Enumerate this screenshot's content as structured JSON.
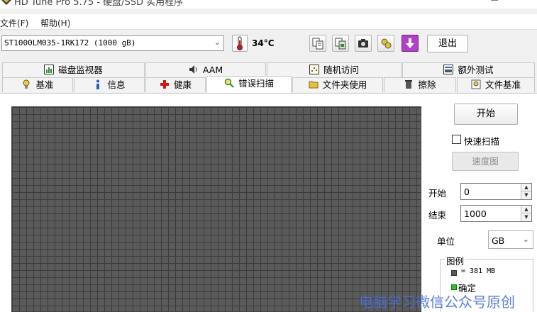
{
  "window": {
    "title": "HD Tune Pro 5.75 - 硬盘/SSD 实用程序",
    "minimize": "–",
    "maximize": "☐",
    "close": "✕"
  },
  "menu": {
    "file": "文件(F)",
    "help": "帮助(H)"
  },
  "toolbar": {
    "drive": "ST1000LM035-1RK172 (1000 gB)",
    "temperature": "34°C",
    "icons": [
      "copy-info-icon",
      "copy-screenshot-icon",
      "camera-icon",
      "options-icon",
      "save-icon"
    ],
    "exit_label": "退出"
  },
  "tabs": {
    "row1": [
      {
        "label": "磁盘监视器",
        "icon": "disk-monitor-icon"
      },
      {
        "label": "AAM",
        "icon": "speaker-icon"
      },
      {
        "label": "随机访问",
        "icon": "random-access-icon"
      },
      {
        "label": "额外测试",
        "icon": "extra-tests-icon"
      }
    ],
    "row2": [
      {
        "label": "基准",
        "icon": "benchmark-icon"
      },
      {
        "label": "信息",
        "icon": "info-icon"
      },
      {
        "label": "健康",
        "icon": "health-icon"
      },
      {
        "label": "错误扫描",
        "icon": "error-scan-icon",
        "active": true
      },
      {
        "label": "文件夹使用",
        "icon": "folder-usage-icon"
      },
      {
        "label": "擦除",
        "icon": "erase-icon"
      },
      {
        "label": "文件基准",
        "icon": "file-benchmark-icon"
      }
    ]
  },
  "scan": {
    "start_button": "开始",
    "quick_scan_label": "快速扫描",
    "quick_scan_checked": false,
    "speed_map_button": "速度图",
    "start_label": "开始",
    "start_value": "0",
    "end_label": "结束",
    "end_value": "1000",
    "unit_label": "单位",
    "unit_value": "GB",
    "legend_title": "图例",
    "legend_block_size": "= 381 MB",
    "legend_ok": "确定",
    "colors": {
      "block_unscanned": "#5a5a5a",
      "block_ok": "#2fbf2f"
    }
  },
  "watermark": "电脑学习微信公众号原创"
}
